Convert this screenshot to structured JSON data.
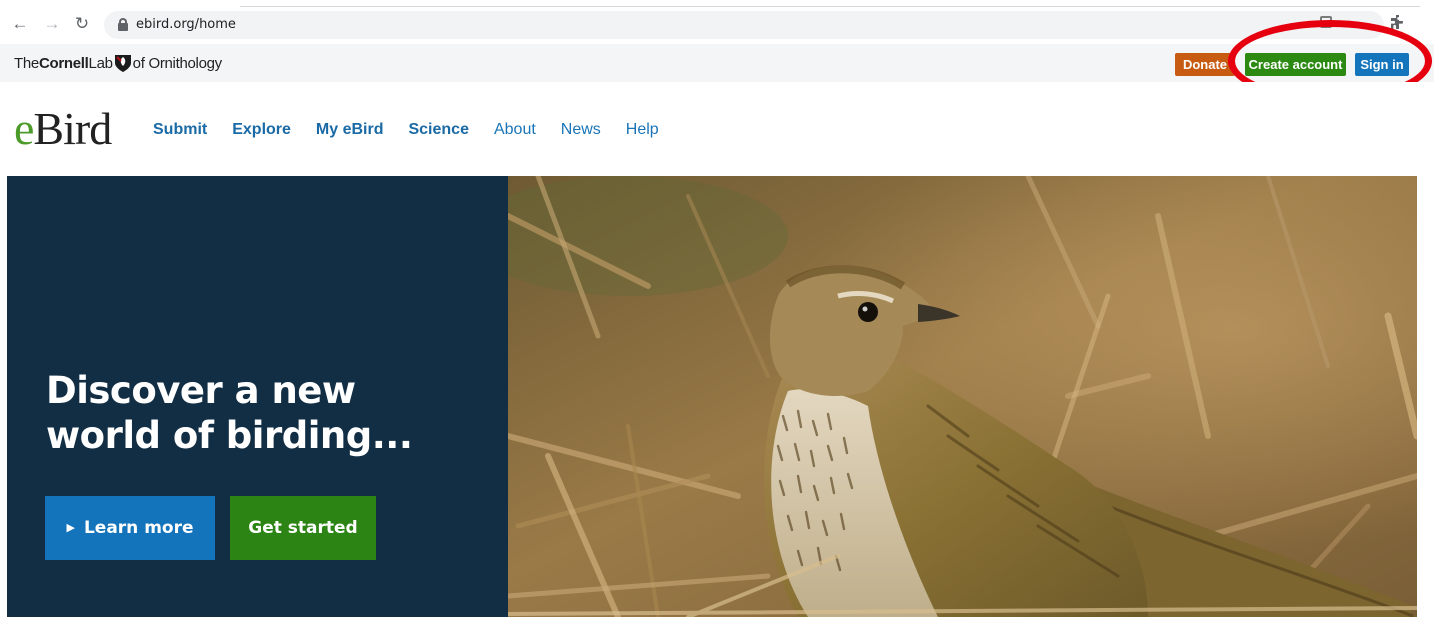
{
  "browser": {
    "url": "ebird.org/home"
  },
  "lab_strip": {
    "logo_the": "The",
    "logo_cornell": "Cornell",
    "logo_lab": "Lab",
    "logo_of": "of Ornithology",
    "donate_label": "Donate",
    "create_account_label": "Create account",
    "sign_in_label": "Sign in"
  },
  "header": {
    "logo_e": "e",
    "logo_bird": "Bird",
    "nav": [
      {
        "label": "Submit"
      },
      {
        "label": "Explore"
      },
      {
        "label": "My eBird"
      },
      {
        "label": "Science"
      },
      {
        "label": "About"
      },
      {
        "label": "News"
      },
      {
        "label": "Help"
      }
    ]
  },
  "hero": {
    "title_line1": "Discover a new",
    "title_line2": "world of birding...",
    "learn_more_label": "Learn more",
    "get_started_label": "Get started"
  },
  "colors": {
    "donate": "#c85b12",
    "create_account": "#2c8a13",
    "sign_in": "#1475bc",
    "hero_panel": "#122e44",
    "annotation_ring": "#e6000f"
  }
}
